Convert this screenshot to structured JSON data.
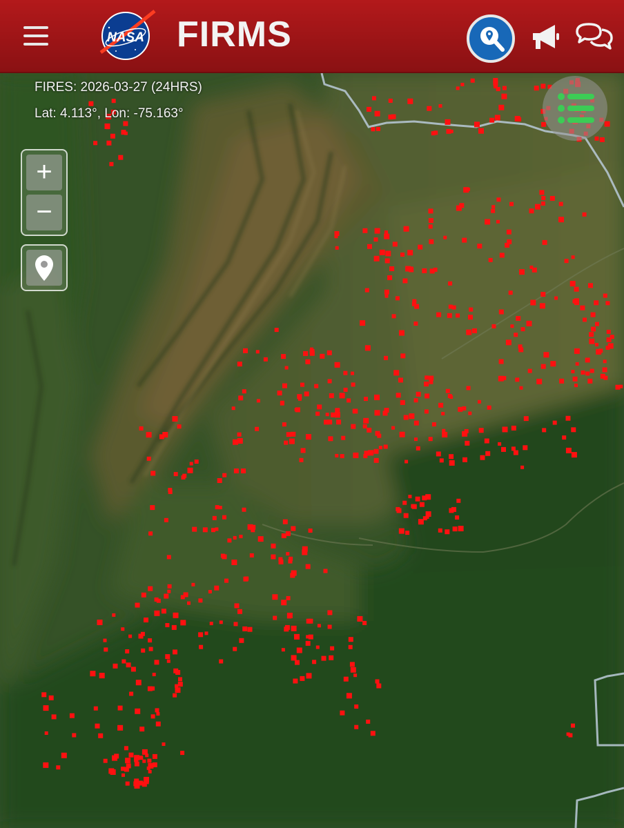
{
  "header": {
    "logo_text": "NASA",
    "title": "FIRMS",
    "menu_icon": "hamburger-menu-icon",
    "search_icon": "search-location-icon",
    "announcements_icon": "megaphone-icon",
    "chat_icon": "chat-bubbles-icon",
    "brand_color": "#a3161a",
    "search_color": "#1868b8"
  },
  "map": {
    "fires_label": "FIRES: 2026-03-27 (24HRS)",
    "coords_label": "Lat: 4.113°, Lon: -75.163°",
    "zoom_in_label": "+",
    "zoom_out_label": "−",
    "locate_icon": "map-pin-icon",
    "layers_icon": "layer-list-icon",
    "fire_color": "#ff1010",
    "layers_icon_color": "#3ccc55"
  }
}
